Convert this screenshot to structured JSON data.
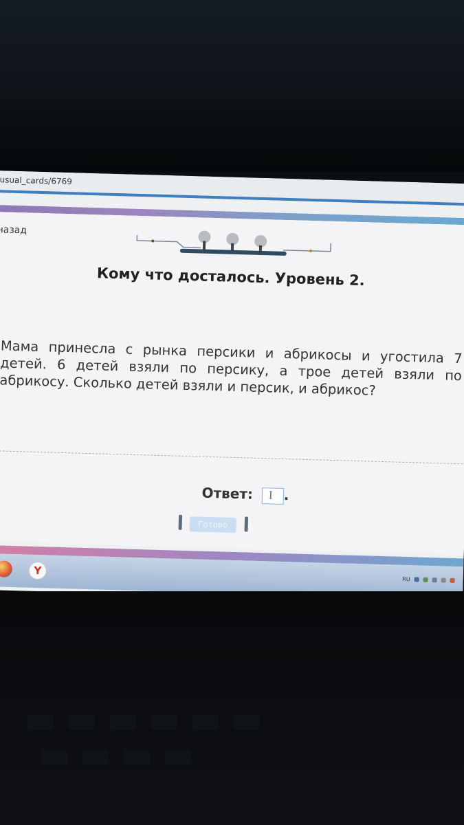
{
  "browser": {
    "address_fragment": "usual_cards/6769"
  },
  "nav": {
    "back_label": "назад"
  },
  "card": {
    "title": "Кому что досталось. Уровень 2.",
    "task_text": "Мама принесла с рынка персики и абрикосы и угостила 7 детей. 6 детей взяли по персику, а трое детей взяли по абрикосу. Сколько детей взяли и персик, и абрикос?",
    "answer_label": "Ответ:",
    "answer_suffix": ".",
    "answer_value": "",
    "ready_button": "Готово"
  },
  "taskbar": {
    "yandex_letter": "Y",
    "language": "RU"
  },
  "colors": {
    "accent_blue": "#3f7fbf",
    "answer_box_border": "#8db1d6",
    "ready_button_bg": "#c9def0"
  }
}
